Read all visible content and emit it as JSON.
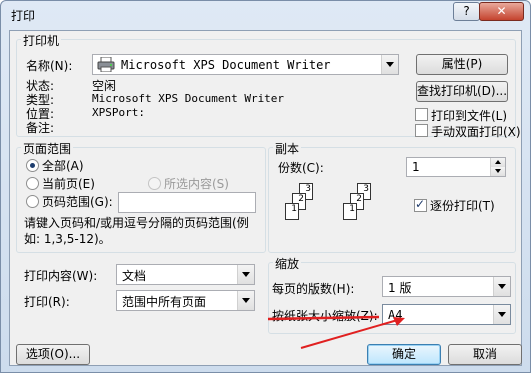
{
  "window": {
    "title": "打印",
    "help_label": "?",
    "close_label": "✕"
  },
  "printer": {
    "group_label": "打印机",
    "name_label": "名称(N):",
    "name_value": "Microsoft XPS Document Writer",
    "properties_button": "属性(P)",
    "find_printer_button": "查找打印机(D)...",
    "status_label": "状态:",
    "status_value": "空闲",
    "type_label": "类型:",
    "type_value": "Microsoft XPS Document Writer",
    "where_label": "位置:",
    "where_value": "XPSPort:",
    "comment_label": "备注:",
    "print_to_file_label": "打印到文件(L)",
    "manual_duplex_label": "手动双面打印(X)"
  },
  "page_range": {
    "group_label": "页面范围",
    "all_label": "全部(A)",
    "current_label": "当前页(E)",
    "selection_label": "所选内容(S)",
    "pages_label": "页码范围(G):",
    "pages_value": "",
    "hint": "请键入页码和/或用逗号分隔的页码范围(例如: 1,3,5-12)。",
    "selected": "all"
  },
  "copies": {
    "group_label": "副本",
    "count_label": "份数(C):",
    "count_value": "1",
    "collate_label": "逐份打印(T)",
    "collate_checked": true,
    "page_digits": [
      "1",
      "2",
      "3"
    ]
  },
  "print_what": {
    "label": "打印内容(W):",
    "value": "文档"
  },
  "print": {
    "label": "打印(R):",
    "value": "范围中所有页面"
  },
  "zoom": {
    "group_label": "缩放",
    "pages_per_sheet_label": "每页的版数(H):",
    "pages_per_sheet_value": "1 版",
    "scale_to_paper_label": "按纸张大小缩放(Z):",
    "scale_to_paper_value": "A4"
  },
  "buttons": {
    "options": "选项(O)...",
    "ok": "确定",
    "cancel": "取消"
  },
  "colors": {
    "annotation_arrow": "#e02020",
    "accent": "#3c7fb1"
  }
}
